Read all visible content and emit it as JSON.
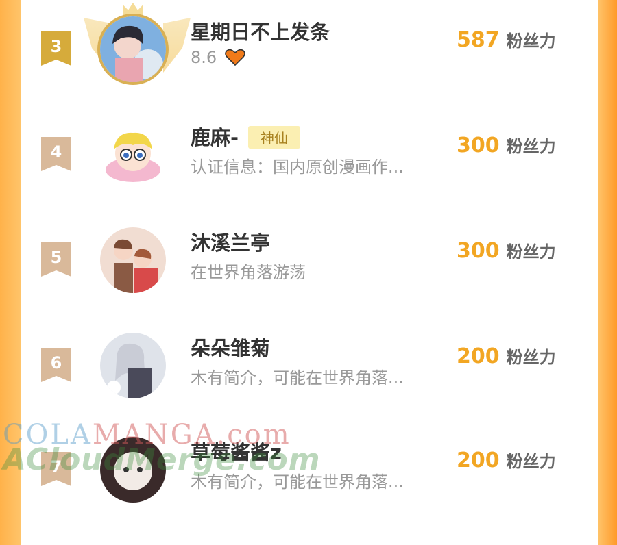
{
  "leaderboard": [
    {
      "rank": "3",
      "name": "星期日不上发条",
      "tag": "",
      "subtitle": "8.6",
      "score": "587",
      "unit": "粉丝力",
      "crowned": true
    },
    {
      "rank": "4",
      "name": "鹿麻-",
      "tag": "神仙",
      "subtitle": "认证信息：国内原创漫画作...",
      "score": "300",
      "unit": "粉丝力",
      "crowned": false
    },
    {
      "rank": "5",
      "name": "沐溪兰亭",
      "tag": "",
      "subtitle": "在世界角落游荡",
      "score": "300",
      "unit": "粉丝力",
      "crowned": false
    },
    {
      "rank": "6",
      "name": "朵朵雏菊",
      "tag": "",
      "subtitle": "木有简介，可能在世界角落...",
      "score": "200",
      "unit": "粉丝力",
      "crowned": false
    },
    {
      "rank": "7",
      "name": "草莓酱酱z",
      "tag": "",
      "subtitle": "木有简介，可能在世界角落...",
      "score": "200",
      "unit": "粉丝力",
      "crowned": false
    }
  ],
  "watermark": {
    "line1a": "COLA",
    "line1b": "MANGA",
    "line1c": ".com",
    "line2": "ACloudMerge.com"
  },
  "colors": {
    "accent": "#f2a623",
    "gold_rank": "#d6ab3b",
    "rank": "#d9b99a",
    "heart": "#f07a1a"
  }
}
